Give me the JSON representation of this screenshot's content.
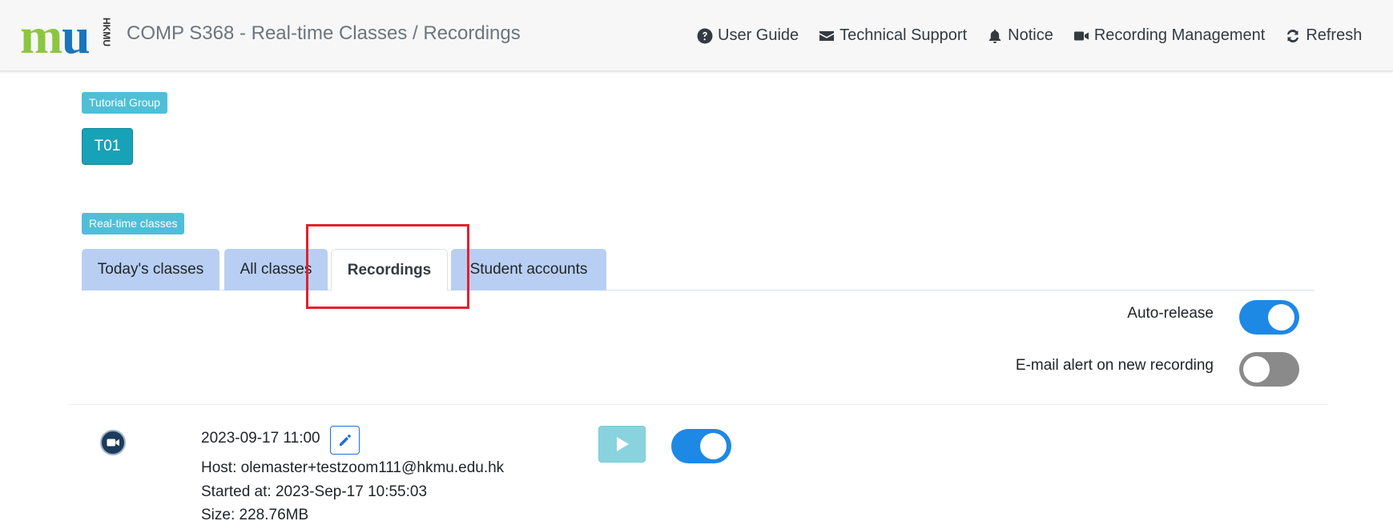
{
  "header": {
    "logo_text": "mu",
    "logo_subtext": "HKMU",
    "title": "COMP S368 - Real-time Classes / Recordings",
    "nav": [
      {
        "label": "User Guide",
        "icon": "question-circle-icon"
      },
      {
        "label": "Technical Support",
        "icon": "envelope-icon"
      },
      {
        "label": "Notice",
        "icon": "bell-icon"
      },
      {
        "label": "Recording Management",
        "icon": "video-camera-icon"
      },
      {
        "label": "Refresh",
        "icon": "refresh-icon"
      }
    ]
  },
  "tutorial": {
    "badge": "Tutorial Group",
    "group": "T01"
  },
  "classes": {
    "badge": "Real-time classes",
    "tabs": [
      {
        "label": "Today's classes",
        "active": false
      },
      {
        "label": "All classes",
        "active": false
      },
      {
        "label": "Recordings",
        "active": true
      },
      {
        "label": "Student accounts",
        "active": false
      }
    ]
  },
  "settings": {
    "auto_release": {
      "label": "Auto-release",
      "on": true
    },
    "email_alert": {
      "label": "E-mail alert on new recording",
      "on": false
    }
  },
  "recording": {
    "datetime": "2023-09-17 11:00",
    "host": "Host: olemaster+testzoom111@hkmu.edu.hk",
    "started": "Started at: 2023-Sep-17 10:55:03",
    "size": "Size: 228.76MB",
    "released": true
  },
  "colors": {
    "accent": "#1e88e5",
    "tab_bg": "#b8cff3",
    "badge_bg": "#4fbfd8",
    "highlight": "#e3202c",
    "logo_green": "#8cc63f",
    "logo_blue": "#1a75bb"
  }
}
